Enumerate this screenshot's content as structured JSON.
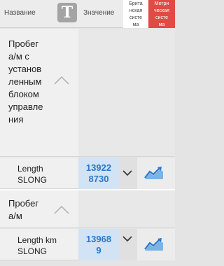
{
  "header": {
    "name_label": "Название",
    "t_button": "T",
    "value_label": "Значение",
    "units": [
      {
        "label": "Брита\nнская\nсисте\nма",
        "active": false
      },
      {
        "label": "Метри\nческая\nсисте\nма",
        "active": true
      }
    ]
  },
  "categories": [
    {
      "title_lines": [
        "Пробег",
        "а/м с",
        "установ",
        "ленным",
        "блоком",
        "управле",
        "ния"
      ]
    },
    {
      "title_lines": [
        "Пробег",
        "а/м"
      ]
    }
  ],
  "params": [
    {
      "label_lines": [
        "Length",
        "SLONG"
      ],
      "value_lines": [
        "13922",
        "8730"
      ]
    },
    {
      "label_lines": [
        "Length km",
        "SLONG"
      ],
      "value_lines": [
        "13968",
        "9"
      ]
    }
  ],
  "colors": {
    "accent": "#2c78c8",
    "value_bg": "#d2e3f5",
    "active_unit_bg": "#e24b44"
  },
  "icons": [
    "t-icon",
    "chevron-up-icon",
    "chevron-down-icon",
    "graph-icon"
  ]
}
